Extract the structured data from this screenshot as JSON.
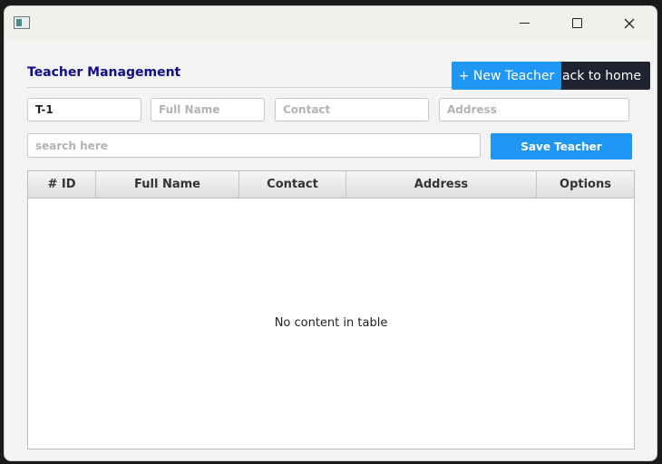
{
  "header": {
    "title": "Teacher Management",
    "new_teacher_label": "+ New Teacher",
    "back_home_label": "Back to home"
  },
  "form": {
    "id_value": "T-1",
    "full_name_placeholder": "Full Name",
    "contact_placeholder": "Contact",
    "address_placeholder": "Address",
    "search_placeholder": "search here",
    "save_label": "Save Teacher"
  },
  "table": {
    "columns": [
      "# ID",
      "Full Name",
      "Contact",
      "Address",
      "Options"
    ],
    "empty_message": "No content in table"
  },
  "colors": {
    "accent": "#1e96f3",
    "title": "#120b8c",
    "dark_button": "#1f2330"
  }
}
